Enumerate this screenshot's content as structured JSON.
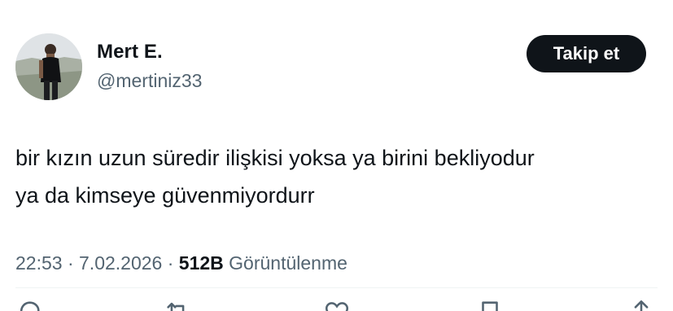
{
  "author": {
    "name": "Mert E.",
    "handle": "@mertiniz33",
    "avatar_icon": "profile-photo"
  },
  "follow_button": {
    "label": "Takip et"
  },
  "tweet": {
    "lines": [
      "bir kızın uzun süredir ilişkisi yoksa ya birini bekliyodur",
      "ya da kimseye güvenmiyordurr"
    ]
  },
  "meta": {
    "time": "22:53",
    "separator": "·",
    "date": "7.02.2026",
    "views_count": "512B",
    "views_label": "Görüntülenme"
  },
  "actions": {
    "reply_icon": "reply-icon",
    "retweet_icon": "retweet-icon",
    "like_icon": "heart-icon",
    "bookmark_icon": "bookmark-icon",
    "share_icon": "share-icon"
  },
  "colors": {
    "text_primary": "#0f1419",
    "text_secondary": "#536471",
    "button_bg": "#0f1419",
    "button_text": "#ffffff",
    "divider": "#eff3f4"
  }
}
